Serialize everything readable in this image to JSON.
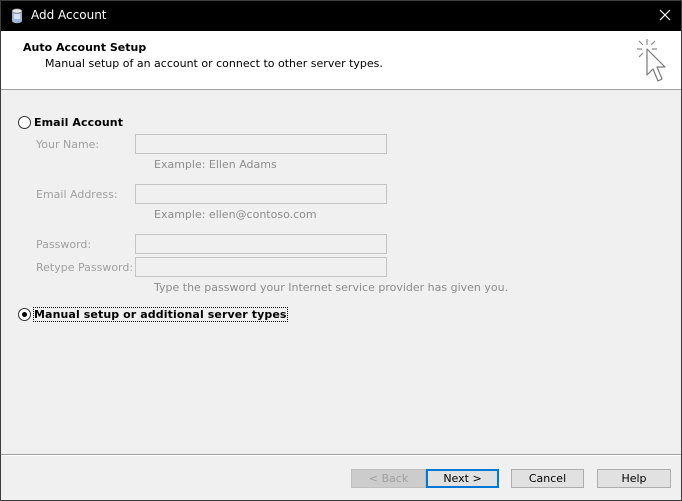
{
  "window": {
    "title": "Add Account"
  },
  "header": {
    "title": "Auto Account Setup",
    "subtitle": "Manual setup of an account or connect to other server types."
  },
  "options": {
    "email_account": {
      "label": "Email Account",
      "checked": false
    },
    "manual_setup": {
      "label": "Manual setup or additional server types",
      "checked": true
    }
  },
  "fields": {
    "your_name": {
      "label": "Your Name:",
      "value": "",
      "hint": "Example: Ellen Adams"
    },
    "email_address": {
      "label": "Email Address:",
      "value": "",
      "hint": "Example: ellen@contoso.com"
    },
    "password": {
      "label": "Password:",
      "value": ""
    },
    "retype_password": {
      "label": "Retype Password:",
      "value": "",
      "hint": "Type the password your Internet service provider has given you."
    }
  },
  "buttons": {
    "back": "< Back",
    "next": "Next >",
    "cancel": "Cancel",
    "help": "Help"
  },
  "icons": {
    "app": "outlook-account-icon",
    "close": "close-icon",
    "cursor": "sparkle-cursor-icon"
  },
  "colors": {
    "titlebar": "#000000",
    "header_bg": "#ffffff",
    "body_bg": "#f0f0f0",
    "disabled_text": "#a0a0a0",
    "default_button_border": "#0078d7"
  }
}
